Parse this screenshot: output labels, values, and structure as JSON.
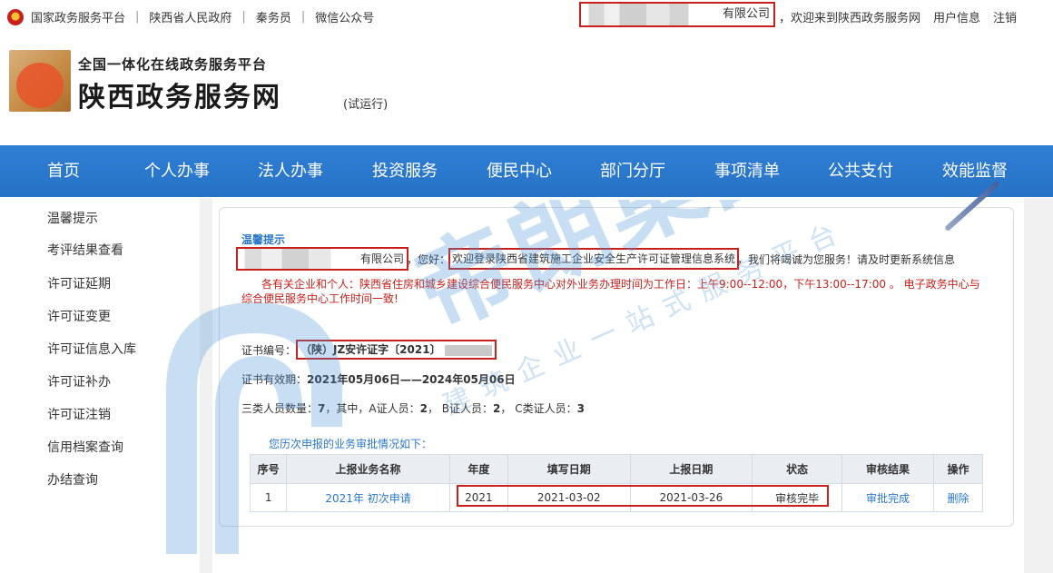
{
  "topbar": {
    "links": [
      "国家政务服务平台",
      "陕西省人民政府",
      "秦务员",
      "微信公众号"
    ],
    "company_suffix": "有限公司",
    "welcome": "，欢迎来到陕西政务服务网",
    "user_info": "用户信息",
    "logout": "注销"
  },
  "header": {
    "subtitle": "全国一体化在线政务服务平台",
    "title": "陕西政务服务网",
    "trial": "(试运行)"
  },
  "nav": {
    "items": [
      "首页",
      "个人办事",
      "法人办事",
      "投资服务",
      "便民中心",
      "部门分厅",
      "事项清单",
      "公共支付",
      "效能监督"
    ]
  },
  "sidebar": {
    "items": [
      "温馨提示",
      "考评结果查看",
      "许可证延期",
      "许可证变更",
      "许可证信息入库",
      "许可证补办",
      "许可证注销",
      "信用档案查询",
      "办结查询"
    ]
  },
  "main": {
    "heading": "温馨提示",
    "company_suffix": "有限公司",
    "greeting_sep": "，您好：",
    "welcome_system": "欢迎登录陕西省建筑施工企业安全生产许可证管理信息系统",
    "service_text": "，我们将竭诚为您服务！请及时更新系统信息",
    "notice": "各有关企业和个人：陕西省住房和城乡建设综合便民服务中心对外业务办理时间为工作日：上午9:00--12:00，下午13:00--17:00 。 电子政务中心与综合便民服务中心工作时间一致!",
    "cert_label": "证书编号：",
    "cert_value": "（陕）JZ安许证字〔2021〕",
    "valid_label": "证书有效期：",
    "valid_value": "2021年05月06日——2024年05月06日",
    "staff_label": "三类人员数量：",
    "staff_total": "7",
    "staff_mid": "，其中，A证人员：",
    "staff_a": "2",
    "staff_b_label": "， B证人员：",
    "staff_b": "2",
    "staff_c_label": "， C类证人员：",
    "staff_c": "3",
    "history_label": "您历次申报的业务审批情况如下："
  },
  "table": {
    "headers": [
      "序号",
      "上报业务名称",
      "年度",
      "填写日期",
      "上报日期",
      "状态",
      "审核结果",
      "操作"
    ],
    "rows": [
      [
        "1",
        "2021年 初次申请",
        "2021",
        "2021-03-02",
        "2021-03-26",
        "审核完毕",
        "审批完成",
        "删除"
      ]
    ]
  },
  "watermark": {
    "big": "帝朗集团",
    "small": "建筑企业一站式服务平台"
  },
  "colors": {
    "nav_bg": "#2f7fd4",
    "link": "#2a78c8",
    "notice_red": "#c8201c",
    "highlight_box": "#c8201c"
  }
}
